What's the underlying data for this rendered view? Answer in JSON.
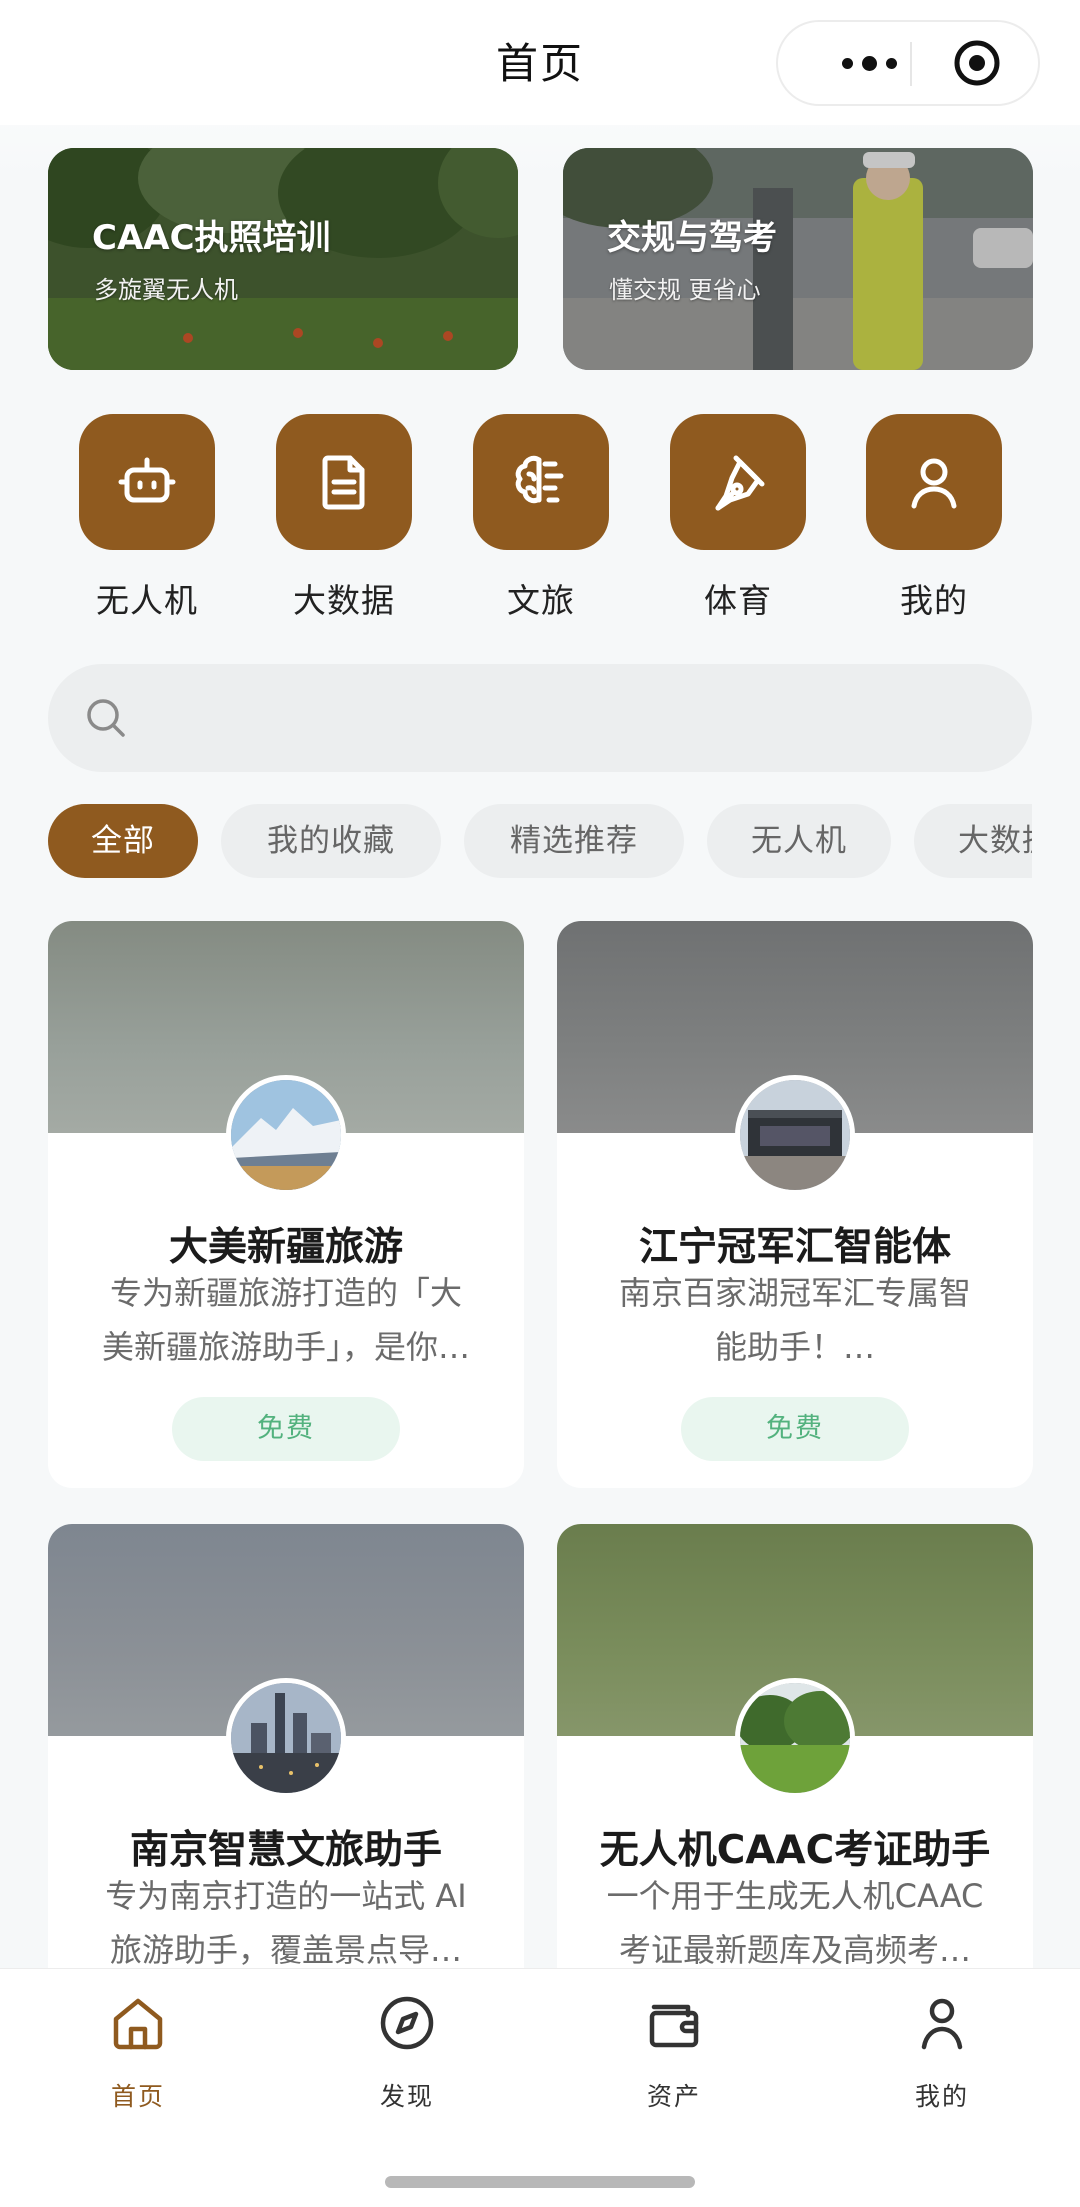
{
  "header": {
    "title": "首页"
  },
  "banners": [
    {
      "title": "CAAC执照培训",
      "subtitle": "多旋翼无人机"
    },
    {
      "title": "交规与驾考",
      "subtitle": "懂交规 更省心"
    }
  ],
  "quick_links": [
    {
      "label": "无人机",
      "icon": "robot-icon"
    },
    {
      "label": "大数据",
      "icon": "document-icon"
    },
    {
      "label": "文旅",
      "icon": "brain-icon"
    },
    {
      "label": "体育",
      "icon": "pen-nib-icon"
    },
    {
      "label": "我的",
      "icon": "user-icon"
    }
  ],
  "search": {
    "placeholder": ""
  },
  "filter_chips": [
    {
      "label": "全部",
      "active": true
    },
    {
      "label": "我的收藏",
      "active": false
    },
    {
      "label": "精选推荐",
      "active": false
    },
    {
      "label": "无人机",
      "active": false
    },
    {
      "label": "大数据",
      "active": false
    }
  ],
  "cards": [
    {
      "title": "大美新疆旅游",
      "desc_line1": "专为新疆旅游打造的「大",
      "desc_line2": "美新疆旅游助手」，是你…",
      "price": "免费"
    },
    {
      "title": "江宁冠军汇智能体",
      "desc_line1": "南京百家湖冠军汇专属智",
      "desc_line2": "能助手！…",
      "price": "免费"
    },
    {
      "title": "南京智慧文旅助手",
      "desc_line1": "专为南京打造的一站式 AI",
      "desc_line2": "旅游助手，覆盖景点导…"
    },
    {
      "title": "无人机CAAC考证助手",
      "desc_line1": "一个用于生成无人机CAAC",
      "desc_line2": "考证最新题库及高频考…"
    }
  ],
  "tabbar": [
    {
      "label": "首页",
      "icon": "home-icon",
      "active": true
    },
    {
      "label": "发现",
      "icon": "compass-icon",
      "active": false
    },
    {
      "label": "资产",
      "icon": "wallet-icon",
      "active": false
    },
    {
      "label": "我的",
      "icon": "user-icon",
      "active": false
    }
  ],
  "colors": {
    "accent": "#8f5a1f",
    "free_badge_text": "#53b27e",
    "free_badge_bg": "#e9f6ef",
    "chip_bg": "#eceeef"
  }
}
